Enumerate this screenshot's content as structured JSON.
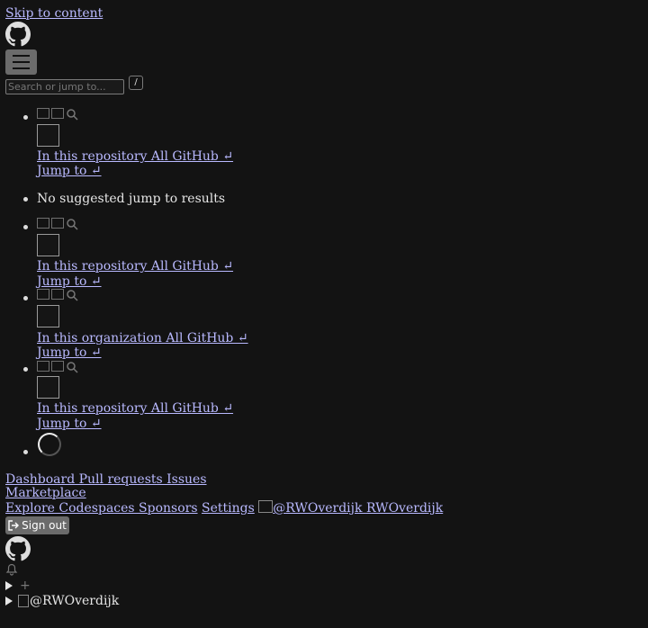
{
  "skip_link": "Skip to content",
  "search": {
    "placeholder": "Search or jump to...",
    "shortcut": "/"
  },
  "suggestion_groups": [
    {
      "scope_label": "In this repository All GitHub ↵",
      "jump_label": "Jump to ↵"
    },
    {
      "scope_label": "In this repository All GitHub ↵",
      "jump_label": "Jump to ↵"
    },
    {
      "scope_label": "In this organization All GitHub ↵",
      "jump_label": "Jump to ↵"
    },
    {
      "scope_label": "In this repository All GitHub ↵",
      "jump_label": "Jump to ↵"
    }
  ],
  "no_results": "No suggested jump to results",
  "nav": {
    "line1": "Dashboard Pull requests Issues",
    "line2": "Marketplace",
    "line3_links": "Explore Codespaces Sponsors",
    "settings": "Settings",
    "user_handle": "@RWOverdijk",
    "user_name": "RWOverdijk"
  },
  "sign_out": "Sign out",
  "bottom": {
    "plus": "+",
    "user_handle": "@RWOverdijk"
  },
  "icons": [
    "github-logo",
    "hamburger",
    "repo",
    "project",
    "search",
    "bell",
    "sign-out",
    "plus",
    "caret-right"
  ]
}
